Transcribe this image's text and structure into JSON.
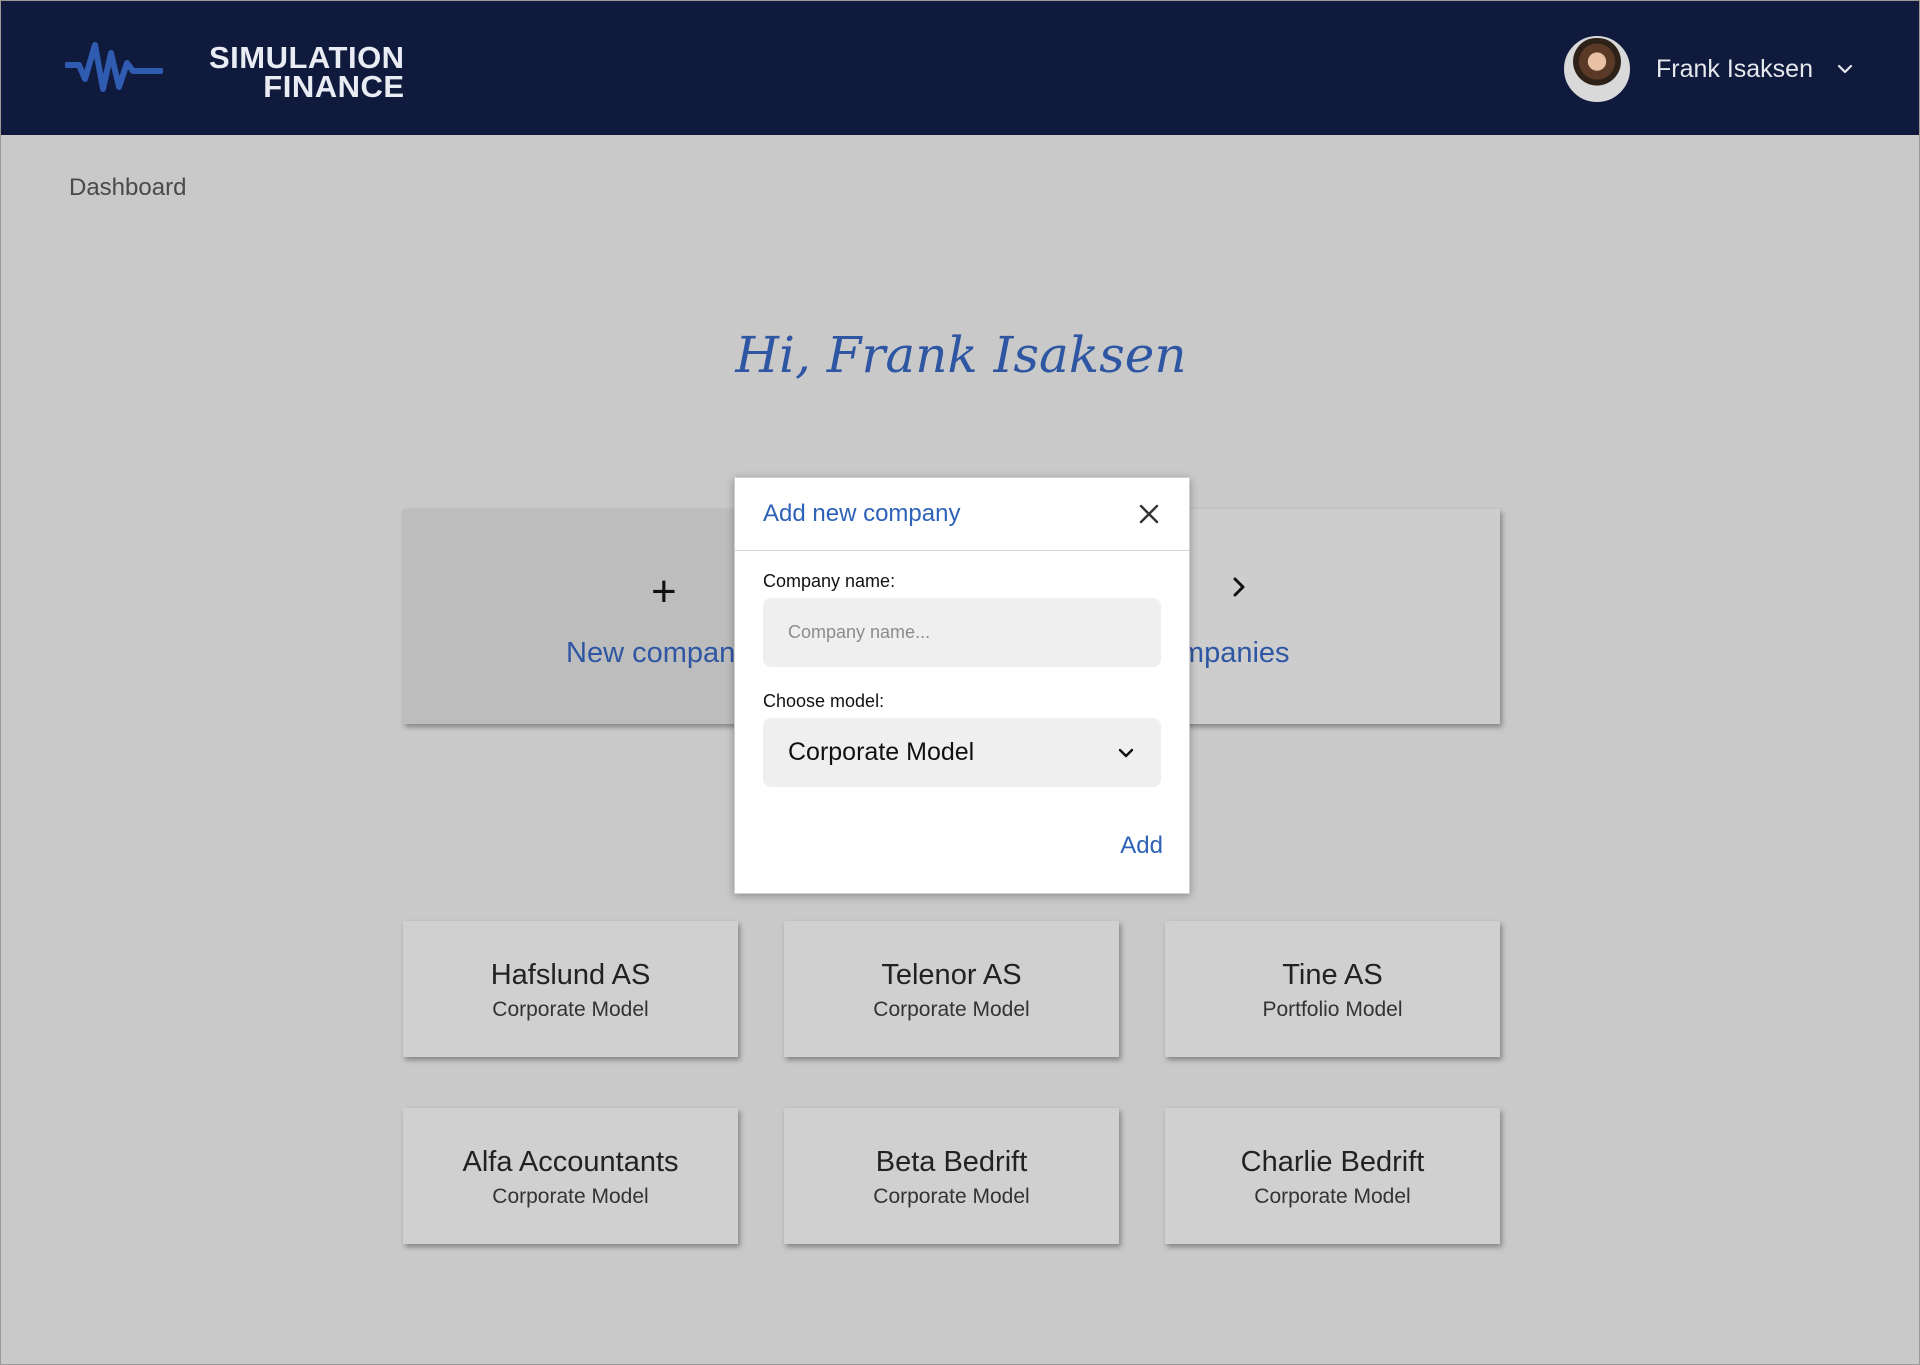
{
  "header": {
    "brand_line1": "SIMULATION",
    "brand_line2": "FINANCE",
    "user_name": "Frank Isaksen"
  },
  "breadcrumb": "Dashboard",
  "greeting": "Hi, Frank Isaksen",
  "actions": {
    "new_company_label": "New company",
    "all_companies_label": "All companies"
  },
  "companies": [
    {
      "name": "Hafslund AS",
      "model": "Corporate Model"
    },
    {
      "name": "Telenor AS",
      "model": "Corporate Model"
    },
    {
      "name": "Tine AS",
      "model": "Portfolio Model"
    },
    {
      "name": "Alfa Accountants",
      "model": "Corporate Model"
    },
    {
      "name": "Beta Bedrift",
      "model": "Corporate Model"
    },
    {
      "name": "Charlie Bedrift",
      "model": "Corporate Model"
    }
  ],
  "modal": {
    "title": "Add new company",
    "company_name_label": "Company name:",
    "company_name_placeholder": "Company name...",
    "company_name_value": "",
    "model_label": "Choose model:",
    "model_selected": "Corporate Model",
    "add_label": "Add"
  },
  "colors": {
    "header_bg": "#0f1a3d",
    "accent_blue": "#2e56a3",
    "backdrop": "#c9c9c9"
  },
  "icons": {
    "logo": "waveform-logo-icon",
    "user_menu": "chevron-down-icon",
    "new_company": "plus-icon",
    "all_companies": "chevron-right-icon",
    "close": "close-icon",
    "select": "chevron-down-icon"
  }
}
